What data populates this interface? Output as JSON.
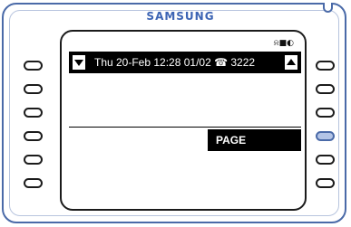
{
  "phone": {
    "brand": "SAMSUNG"
  },
  "display": {
    "status_icons": "⍾■◐",
    "status_line": "Thu 20-Feb 12:28  01/02 ☎ 3222"
  },
  "soft_keys": {
    "page_label": "PAGE"
  },
  "colors": {
    "body_outline": "#4a6aa8",
    "active_key_fill": "#b3c4e6",
    "lcd_inverse": "#000000"
  }
}
